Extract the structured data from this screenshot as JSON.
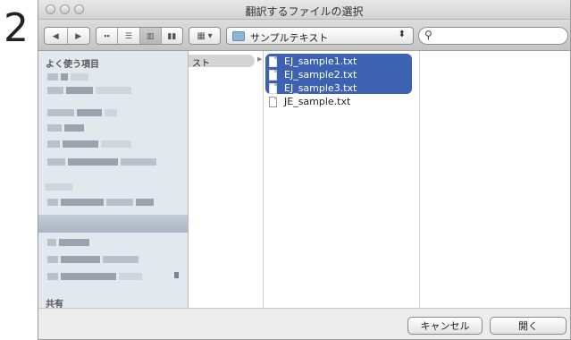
{
  "step_number": "2",
  "window": {
    "title": "翻訳するファイルの選択"
  },
  "toolbar": {
    "back_icon": "chevron-left-icon",
    "forward_icon": "chevron-right-icon",
    "path_label": "サンプルテキスト",
    "view_modes": [
      "icon-view",
      "list-view",
      "column-view",
      "coverflow-view"
    ],
    "active_view": "column-view"
  },
  "sidebar": {
    "favorites_header": "よく使う項目",
    "shared_header": "共有"
  },
  "column1": {
    "selected_label": "スト"
  },
  "files": [
    {
      "name": "EJ_sample1.txt",
      "selected": true
    },
    {
      "name": "EJ_sample2.txt",
      "selected": true
    },
    {
      "name": "EJ_sample3.txt",
      "selected": true
    },
    {
      "name": "JE_sample.txt",
      "selected": false
    }
  ],
  "buttons": {
    "cancel": "キャンセル",
    "open": "開く"
  },
  "colors": {
    "selection": "#3c62b1",
    "sidebar": "#e3e8ee"
  }
}
